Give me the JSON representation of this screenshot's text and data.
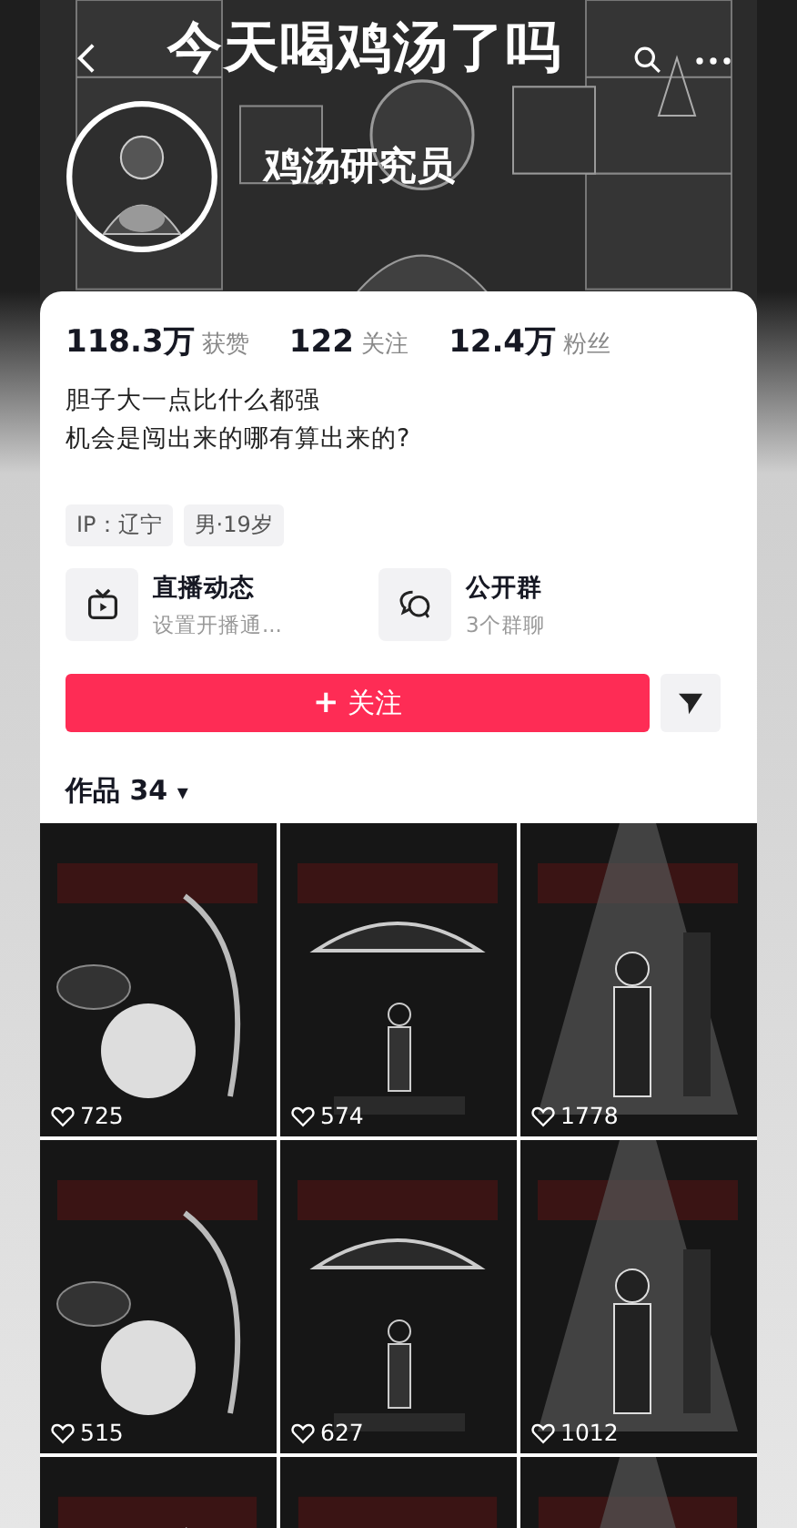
{
  "header": {
    "caption": "今天喝鸡汤了吗",
    "name": "鸡汤研究员"
  },
  "stats": [
    "**118.3万** 获赞",
    "**122** 关注",
    "**12.4万** 粉丝"
  ],
  "bio": [
    "胆子大一点比什么都强",
    "机会是闯出来的哪有算出来的?"
  ],
  "tags": [
    "IP：辽宁",
    "男·19岁"
  ],
  "features": [
    {
      "kind": "tv",
      "title": "直播动态",
      "subtitle": "设置开播通..."
    },
    {
      "kind": "chat",
      "title": "公开群",
      "subtitle": "3个群聊"
    }
  ],
  "follow_button": {
    "icon": "+",
    "label": "关注"
  },
  "works_tab": {
    "label": "作品 34",
    "caret": "▾"
  },
  "works": [
    {
      "kind": "picture",
      "likes": "725"
    },
    {
      "kind": "picture",
      "likes": "574"
    },
    {
      "kind": "picture",
      "likes": "1778"
    },
    {
      "kind": "picture",
      "likes": "515"
    },
    {
      "kind": "picture",
      "likes": "627"
    },
    {
      "kind": "picture",
      "likes": "1012"
    },
    {
      "kind": "picture"
    },
    {
      "kind": "picture"
    },
    {
      "kind": "picture"
    }
  ]
}
